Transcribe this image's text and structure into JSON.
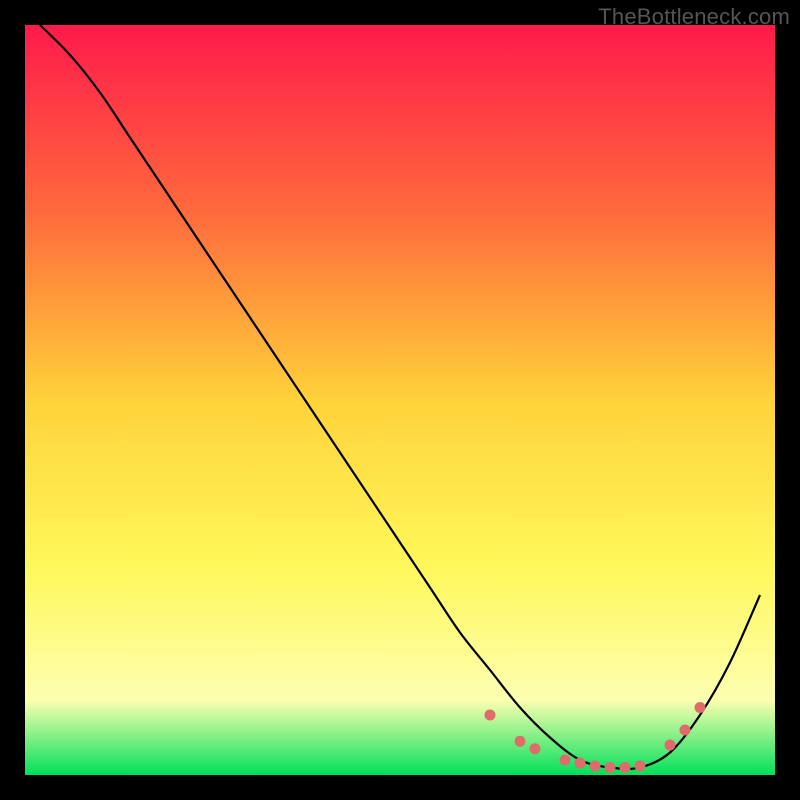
{
  "watermark": "TheBottleneck.com",
  "chart_data": {
    "type": "line",
    "title": "",
    "xlabel": "",
    "ylabel": "",
    "xlim": [
      0,
      100
    ],
    "ylim": [
      0,
      100
    ],
    "background_gradient": {
      "stops": [
        {
          "offset": 0,
          "color": "#ff1a4b"
        },
        {
          "offset": 25,
          "color": "#ff6a3c"
        },
        {
          "offset": 50,
          "color": "#ffd23a"
        },
        {
          "offset": 72,
          "color": "#fff85a"
        },
        {
          "offset": 90,
          "color": "#fdffb0"
        },
        {
          "offset": 100,
          "color": "#00e05a"
        }
      ]
    },
    "series": [
      {
        "name": "curve",
        "color": "#000000",
        "x": [
          2,
          6,
          10,
          14,
          18,
          22,
          26,
          30,
          34,
          38,
          42,
          46,
          50,
          54,
          58,
          62,
          66,
          70,
          74,
          78,
          82,
          86,
          90,
          94,
          98
        ],
        "y": [
          100,
          96,
          91,
          85,
          79,
          73,
          67,
          61,
          55,
          49,
          43,
          37,
          31,
          25,
          19,
          14,
          9,
          5,
          2,
          1,
          1,
          3,
          8,
          15,
          24
        ]
      }
    ],
    "markers": {
      "name": "bottom-dots",
      "color": "#e06b6b",
      "x": [
        62,
        66,
        68,
        72,
        74,
        76,
        78,
        80,
        82,
        86,
        88,
        90
      ],
      "y": [
        8,
        4.5,
        3.5,
        2,
        1.6,
        1.2,
        1.0,
        1.0,
        1.2,
        4,
        6,
        9
      ]
    }
  }
}
